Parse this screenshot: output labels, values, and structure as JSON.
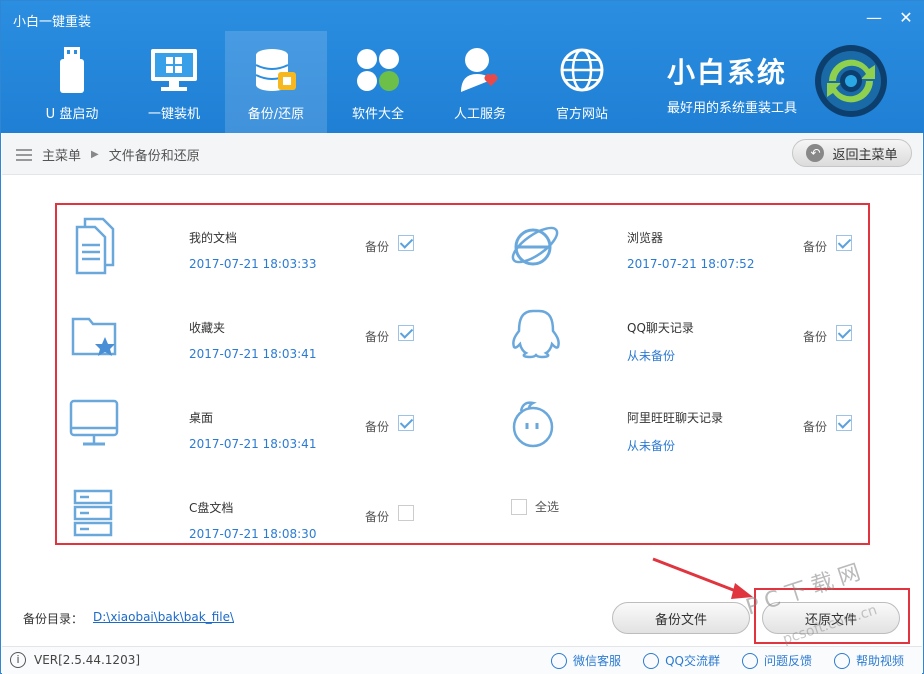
{
  "window": {
    "title": "小白一键重装",
    "minimize": "—",
    "close": "✕"
  },
  "nav": [
    {
      "label": "U 盘启动",
      "icon": "usb-icon",
      "active": false
    },
    {
      "label": "一键装机",
      "icon": "monitor-windows-icon",
      "active": false
    },
    {
      "label": "备份/还原",
      "icon": "database-backup-icon",
      "active": true
    },
    {
      "label": "软件大全",
      "icon": "apps-clover-icon",
      "active": false
    },
    {
      "label": "人工服务",
      "icon": "user-heart-icon",
      "active": false
    },
    {
      "label": "官方网站",
      "icon": "globe-icon",
      "active": false
    }
  ],
  "brand": {
    "name": "小白系统",
    "slogan": "最好用的系统重装工具"
  },
  "breadcrumb": {
    "root": "主菜单",
    "current": "文件备份和还原"
  },
  "back_button": "返回主菜单",
  "items": [
    {
      "title": "我的文档",
      "date": "2017-07-21 18:03:33",
      "backup_label": "备份",
      "checked": true,
      "icon": "documents-icon"
    },
    {
      "title": "浏览器",
      "date": "2017-07-21 18:07:52",
      "backup_label": "备份",
      "checked": true,
      "icon": "browser-ie-icon"
    },
    {
      "title": "收藏夹",
      "date": "2017-07-21 18:03:41",
      "backup_label": "备份",
      "checked": true,
      "icon": "favorites-folder-icon"
    },
    {
      "title": "QQ聊天记录",
      "date": "从未备份",
      "backup_label": "备份",
      "checked": true,
      "icon": "qq-penguin-icon"
    },
    {
      "title": "桌面",
      "date": "2017-07-21 18:03:41",
      "backup_label": "备份",
      "checked": true,
      "icon": "desktop-monitor-icon"
    },
    {
      "title": "阿里旺旺聊天记录",
      "date": "从未备份",
      "backup_label": "备份",
      "checked": true,
      "icon": "wangwang-icon"
    },
    {
      "title": "C盘文档",
      "date": "2017-07-21 18:08:30",
      "backup_label": "备份",
      "checked": false,
      "icon": "server-drive-icon"
    }
  ],
  "select_all": "全选",
  "backup_dir": {
    "label": "备份目录：",
    "path": "D:\\xiaobai\\bak\\bak_file\\"
  },
  "buttons": {
    "backup": "备份文件",
    "restore": "还原文件"
  },
  "watermark": {
    "main": "PC下载网",
    "sub": "pcsoft.com.cn"
  },
  "footer": {
    "version": "VER[2.5.44.1203]",
    "links": [
      "微信客服",
      "QQ交流群",
      "问题反馈",
      "帮助视频"
    ]
  },
  "colors": {
    "header": "#2288dd",
    "accent": "#2c7bd2",
    "highlight": "#e0343f"
  }
}
